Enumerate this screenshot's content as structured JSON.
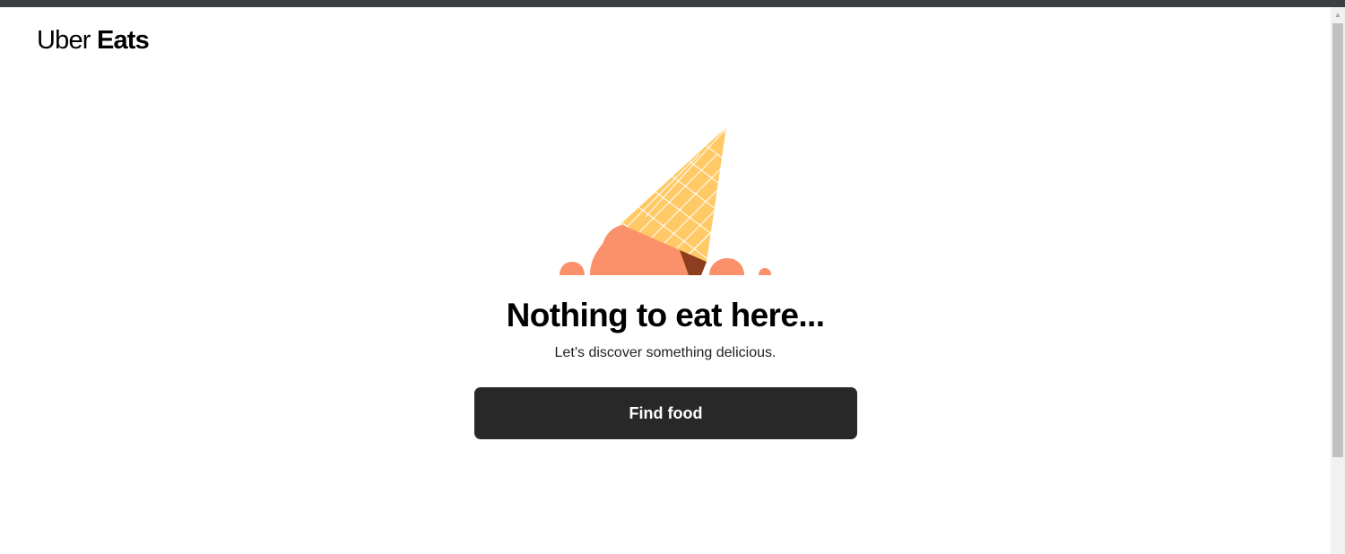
{
  "header": {
    "logo_uber": "Uber",
    "logo_eats": "Eats"
  },
  "empty_state": {
    "title": "Nothing to eat here...",
    "subtitle": "Let’s discover something delicious.",
    "cta_label": "Find food"
  },
  "scrollbar": {
    "up_arrow": "▲"
  },
  "colors": {
    "top_bar": "#3a3f41",
    "button_bg": "#282828",
    "cone": "#ffc966",
    "ice_cream": "#fa916b",
    "chocolate": "#8c3e1e"
  }
}
